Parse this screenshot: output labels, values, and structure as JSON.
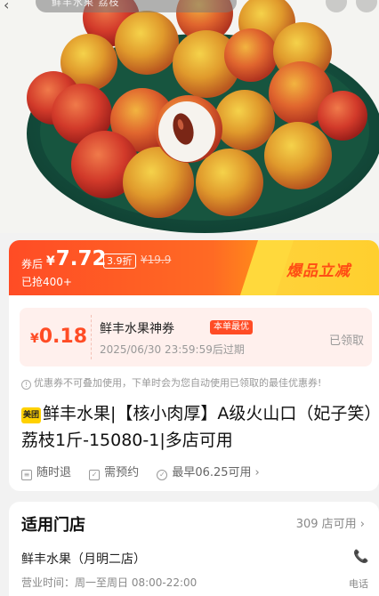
{
  "header": {
    "back_icon": "chevron-left-icon",
    "search_text": "鲜丰水果 荔枝"
  },
  "price_banner": {
    "coupon_after_label": "券后",
    "currency": "¥",
    "price": "7.72",
    "discount": "3.9折",
    "original_price": "¥19.9",
    "sold": "已抢400+",
    "hot_label": "爆品立减",
    "colors": {
      "accent": "#ff4c25",
      "highlight": "#ffd23a"
    }
  },
  "coupon": {
    "currency": "¥",
    "amount": "0.18",
    "name": "鲜丰水果神券",
    "badge": "本单最优",
    "expire": "2025/06/30 23:59:59后过期",
    "status": "已领取"
  },
  "notice": "优惠券不可叠加使用，下单时会为您自动使用已领取的最佳优惠券!",
  "product": {
    "logo_text": "美团",
    "title": "鲜丰水果|【核小肉厚】A级火山口（妃子笑）荔枝1斤-15080-1|多店可用"
  },
  "tags": [
    {
      "icon": "receipt-icon",
      "label": "随时退"
    },
    {
      "icon": "calendar-check-icon",
      "label": "需预约"
    },
    {
      "icon": "check-circle-icon",
      "label": "最早06.25可用"
    }
  ],
  "store": {
    "section_title": "适用门店",
    "count_label": "309 店可用",
    "name": "鲜丰水果（月明二店）",
    "hours": "营业时间：周一至周日 08:00-22:00",
    "phone_label": "电话"
  }
}
